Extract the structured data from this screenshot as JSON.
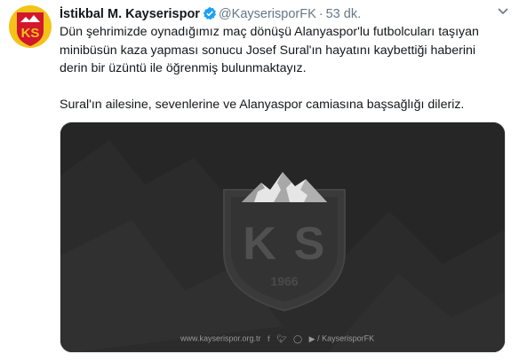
{
  "tweet": {
    "display_name": "İstikbal M. Kayserispor",
    "handle": "@KayserisporFK",
    "separator": "·",
    "time": "53 dk.",
    "paragraphs": [
      "Dün şehrimizde oynadığımız maç dönüşü Alanyaspor'lu futbolcuları taşıyan minibüsün kaza yapması sonucu Josef Sural'ın hayatını kaybettiği haberini derin bir üzüntü ile öğrenmiş bulunmaktayız.",
      "Sural'ın ailesine, sevenlerine ve Alanyaspor camiasına başsağlığı dileriz."
    ]
  },
  "avatar": {
    "letters": "KS",
    "colors": {
      "yellow": "#f3c317",
      "red": "#d3172c"
    }
  },
  "media": {
    "crest_letters_left": "K",
    "crest_letters_right": "S",
    "crest_year": "1966",
    "website": "www.kayserispor.org.tr",
    "social_handle": "/ KayserisporFK",
    "social_icons": [
      "facebook-icon",
      "twitter-icon",
      "instagram-icon",
      "youtube-icon"
    ],
    "colors": {
      "background": "#262626",
      "crest": "#3a3a3a",
      "text": "#9a9a9a"
    }
  }
}
